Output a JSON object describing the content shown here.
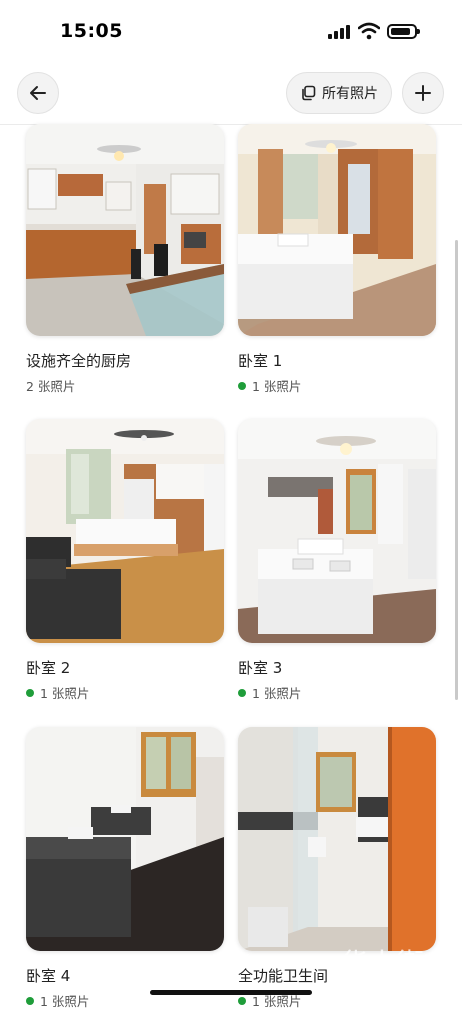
{
  "status_bar": {
    "time": "15:05"
  },
  "header": {
    "all_photos_label": "所有照片"
  },
  "rooms": [
    {
      "title": "设施齐全的厨房",
      "count": "2 张照片",
      "dot": false
    },
    {
      "title": "卧室 1",
      "count": "1 张照片",
      "dot": true
    },
    {
      "title": "卧室 2",
      "count": "1 张照片",
      "dot": true
    },
    {
      "title": "卧室 3",
      "count": "1 张照片",
      "dot": true
    },
    {
      "title": "卧室 4",
      "count": "1 张照片",
      "dot": true
    },
    {
      "title": "全功能卫生间",
      "count": "1 张照片",
      "dot": true
    }
  ],
  "watermark": {
    "text": "华人街",
    "sub": "HUAREN.JIEI"
  },
  "colors": {
    "status_dot": "#1f9d3a",
    "button_bg": "#f3f3f3"
  }
}
